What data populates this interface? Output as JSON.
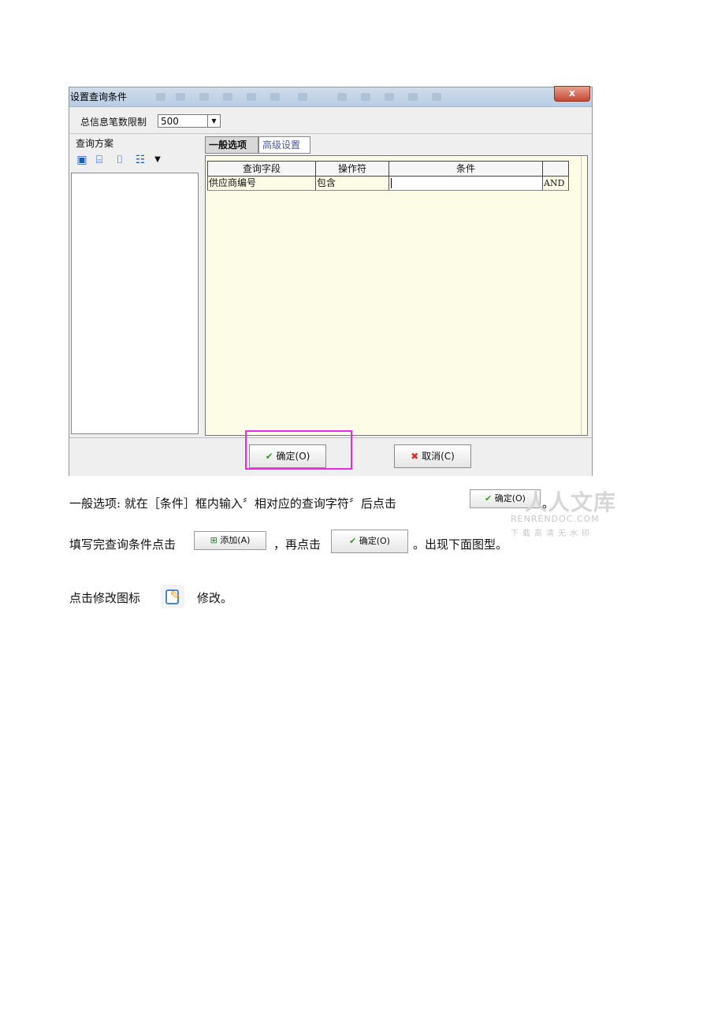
{
  "dialog": {
    "title": "设置查询条件",
    "close_label": "x",
    "limit_label": "总信息笔数限制",
    "limit_value": "500",
    "plan_title": "查询方案",
    "tabs": [
      "一般选项",
      "高级设置"
    ],
    "columns": [
      "查询字段",
      "操作符",
      "条件",
      ""
    ],
    "rows": [
      {
        "field": "供应商编号",
        "operator": "包含",
        "condition": "",
        "logic": "AND"
      }
    ],
    "ok_label": "确定(O)",
    "cancel_label": "取消(C)"
  },
  "text": {
    "line1": "一般选项: 就在［条件］框内输入〞相对应的查询字符〞后点击",
    "line1_end": "。",
    "line2_start": "填写完查询条件点击",
    "line2_mid": "，再点击",
    "line2_end": "。出现下面图型。",
    "line3_start": "点击修改图标",
    "line3_end": "修改。"
  },
  "inline_buttons": {
    "ok": "确定(O)",
    "add": "添加(A)"
  },
  "watermark": {
    "brand": "人人文库",
    "url": "RENRENDOC.COM",
    "tagline": "下载高清无水印"
  },
  "colors": {
    "highlight": "#e52ee0",
    "grid_bg": "#fdfde7"
  },
  "icons": [
    "save-icon",
    "open-folder-icon",
    "delete-icon",
    "columns-icon",
    "check-icon",
    "cancel-x-icon",
    "add-icon",
    "edit-icon"
  ]
}
